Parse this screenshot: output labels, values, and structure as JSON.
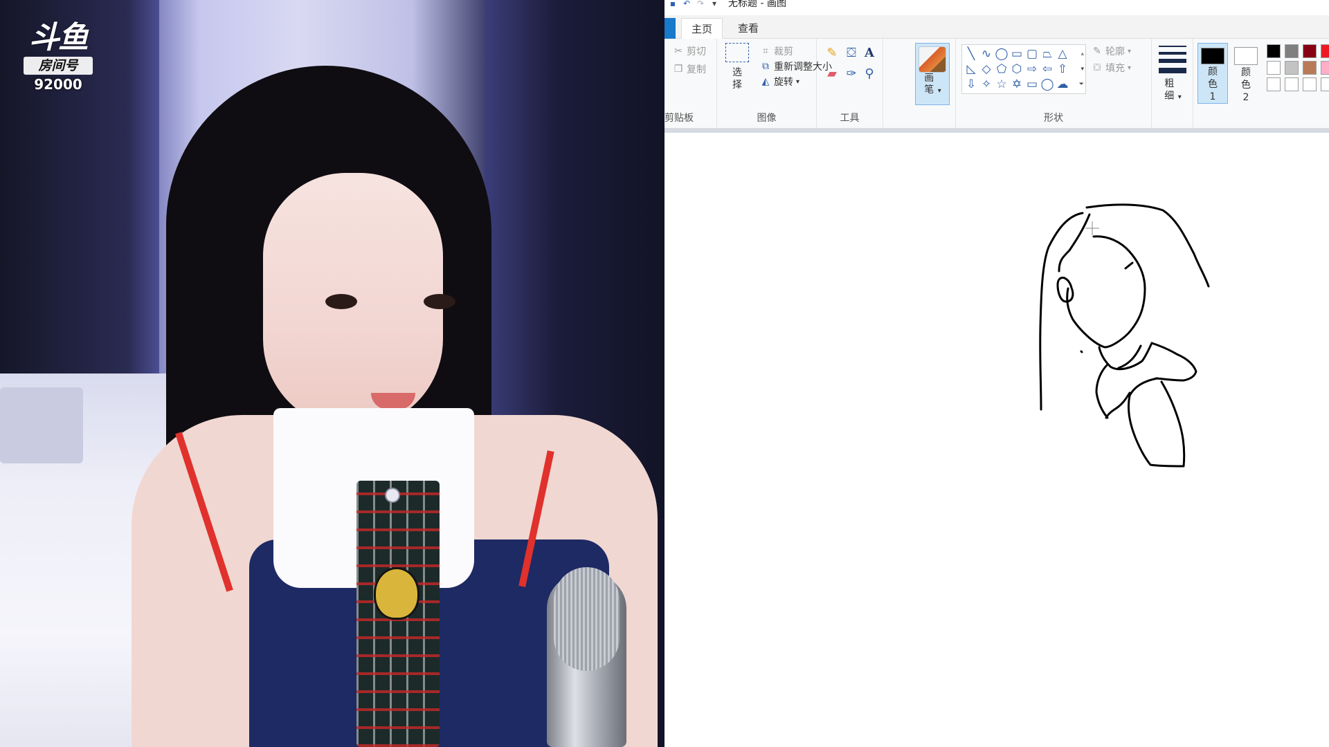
{
  "stream": {
    "platform_logo": "斗鱼",
    "room_label": "房间号",
    "room_number": "92000"
  },
  "paint": {
    "title": "无标题 - 画图",
    "tabs": [
      {
        "label": "主页",
        "active": true
      },
      {
        "label": "查看",
        "active": false
      }
    ],
    "clipboard": {
      "cut": "剪切",
      "copy": "复制",
      "group_label": "剪贴板"
    },
    "image": {
      "select": "选择",
      "crop": "裁剪",
      "resize": "重新调整大小",
      "rotate": "旋转",
      "group_label": "图像"
    },
    "tools": {
      "group_label": "工具",
      "icons": [
        "pencil-icon",
        "fill-icon",
        "text-icon",
        "eraser-icon",
        "color-picker-icon",
        "magnifier-icon"
      ]
    },
    "brushes": {
      "label": "画笔"
    },
    "shapes": {
      "outline": "轮廓",
      "fill": "填充",
      "group_label": "形状"
    },
    "size": {
      "label": "粗细"
    },
    "colors": {
      "color1_label": "颜色 1",
      "color2_label": "颜色 2",
      "color1": "#000000",
      "color2": "#ffffff",
      "palette": [
        "#000000",
        "#7f7f7f",
        "#880015",
        "#ed1c24",
        "#ffffff",
        "#c3c3c3",
        "#b97a57",
        "#ffaec9",
        "#ffffff",
        "#ffffff",
        "#ffffff",
        "#ffffff"
      ]
    }
  }
}
